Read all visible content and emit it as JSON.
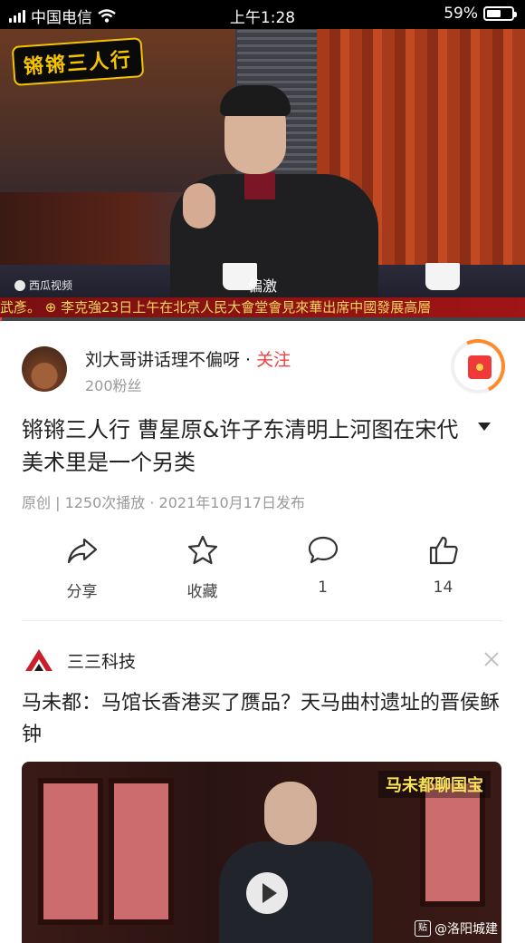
{
  "status_bar": {
    "carrier": "中国电信",
    "time": "上午1:28",
    "battery_percent": "59%",
    "battery_level": 0.59
  },
  "video": {
    "show_logo": "锵锵三人行",
    "watermark": "西瓜视频",
    "subtitle": "偏激",
    "ticker": "武彥。 ⊕ 李克強23日上午在北京人民大會堂會見來華出席中國發展高層",
    "progress": 0.004
  },
  "author": {
    "name": "刘大哥讲话理不偏呀",
    "separator": " · ",
    "follow_label": "关注",
    "fans": "200粉丝",
    "redpack_icon": "red-envelope-icon"
  },
  "article": {
    "title": "锵锵三人行 曹星原&许子东清明上河图在宋代美术里是一个另类",
    "meta": "原创 | 1250次播放 · 2021年10月17日发布"
  },
  "actions": [
    {
      "icon": "share-icon",
      "label": "分享"
    },
    {
      "icon": "star-icon",
      "label": "收藏"
    },
    {
      "icon": "comment-icon",
      "label": "1"
    },
    {
      "icon": "thumbs-up-icon",
      "label": "14"
    }
  ],
  "next_card": {
    "source": "三三科技",
    "title": "马未都：马馆长香港买了赝品？天马曲村遗址的晋侯稣钟",
    "thumb_badge": "马未都聊国宝",
    "thumb_watermark": "@洛阳城建",
    "thumb_watermark_icon": "贴"
  },
  "colors": {
    "accent_red": "#f04142",
    "meta_gray": "#999999",
    "ring_orange": "#ff8a2a"
  }
}
